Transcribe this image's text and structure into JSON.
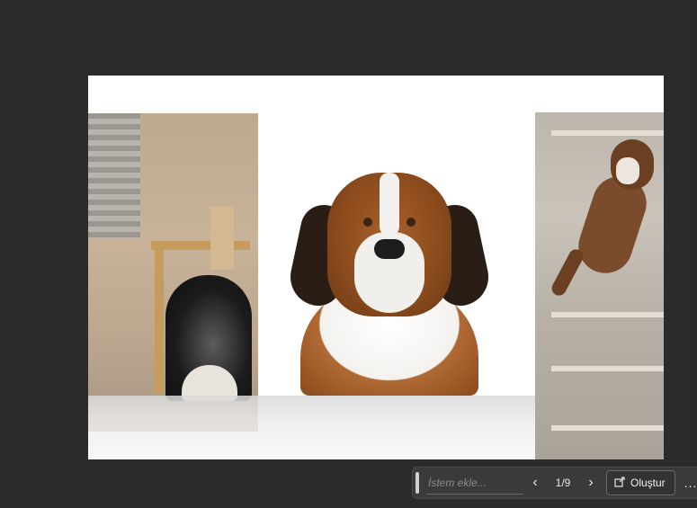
{
  "canvas": {
    "image_alt": "Three dog images: a black long-haired dog in a wooden interior, a Saint Bernard portrait, and a jumping brown dog"
  },
  "toolbar": {
    "prompt_placeholder": "İstem ekle...",
    "prev_icon": "chevron-left-icon",
    "next_icon": "chevron-right-icon",
    "page_indicator": "1/9",
    "create_label": "Oluştur",
    "create_icon": "create-icon",
    "more_label": "...",
    "more_icon": "more-icon"
  },
  "colors": {
    "background": "#2b2b2b",
    "toolbar_bg": "#3a3a3a",
    "canvas_bg": "#ffffff"
  }
}
